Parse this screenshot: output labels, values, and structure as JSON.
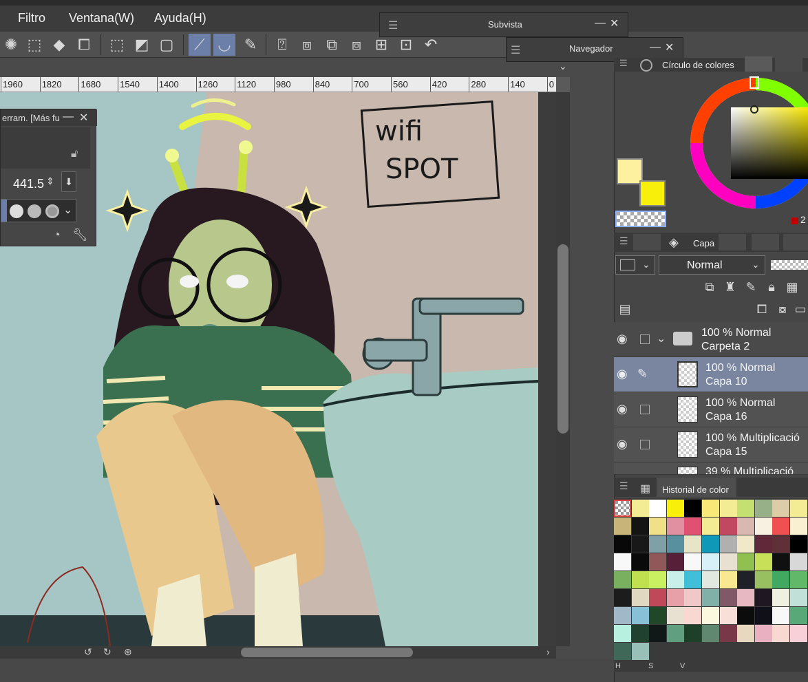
{
  "menu": {
    "items": [
      "Filtro",
      "Ventana(W)",
      "Ayuda(H)"
    ]
  },
  "subvista": {
    "title": "Subvista"
  },
  "navegador": {
    "title": "Navegador"
  },
  "ruler": {
    "labels": [
      "1960",
      "1820",
      "1680",
      "1540",
      "1400",
      "1260",
      "1120",
      "980",
      "840",
      "700",
      "560",
      "420",
      "280",
      "140",
      "0"
    ]
  },
  "tool_property": {
    "title": "erram. [Más fu",
    "brush_size": "441.5"
  },
  "color_panel": {
    "tab_label": "Círculo de colores",
    "main_color": "#fdf1a0",
    "sub_color": "#f8f00a",
    "counter": "2"
  },
  "layers": {
    "tab_label": "Capa",
    "blend_mode": "Normal",
    "rows": [
      {
        "opacity_mode": "100 % Normal",
        "name": "Carpeta 2"
      },
      {
        "opacity_mode": "100 % Normal",
        "name": "Capa 10"
      },
      {
        "opacity_mode": "100 % Normal",
        "name": "Capa 16"
      },
      {
        "opacity_mode": "100 % Multiplicació",
        "name": "Capa 15"
      },
      {
        "opacity_mode": "39 % Multiplicació",
        "name": ""
      }
    ]
  },
  "color_history": {
    "tab_label": "Historial de color",
    "footer_labels": [
      "H",
      "S",
      "V"
    ],
    "swatches": [
      "#f4ec94",
      "#ffffff",
      "#f8f00a",
      "#000000",
      "#f8e878",
      "#f4ec94",
      "#c4e070",
      "#98b088",
      "#dccca8",
      "#f4ec94",
      "#c8b478",
      "#141414",
      "#f0e088",
      "#e090a0",
      "#e05070",
      "#f4ec94",
      "#c04860",
      "#d8b8b0",
      "#f8f0e0",
      "#f05050",
      "#f8f0d0",
      "#080808",
      "#181818",
      "#80a0a8",
      "#5890a0",
      "#e8e4c8",
      "#1098b8",
      "#b0b0b0",
      "#f0e8c8",
      "#602838",
      "#603038",
      "#000000",
      "#f8f8f8",
      "#0a0a0a",
      "#905858",
      "#582038",
      "#f8f8f8",
      "#d8f0f8",
      "#e8e0d0",
      "#90c050",
      "#c8e058",
      "#101010",
      "#d8d8d8",
      "#78b060",
      "#c0e050",
      "#c8f060",
      "#c8f0e8",
      "#40c0d8",
      "#e0e8e0",
      "#f8e890",
      "#202028",
      "#98c060",
      "#40a860",
      "#60b868",
      "#1c1c1c",
      "#e0d8c0",
      "#c04858",
      "#e8a0a8",
      "#f0c8c8",
      "#80b0a8",
      "#805868",
      "#e8b8c0",
      "#201820",
      "#f0f0e0",
      "#c0e0d8",
      "#a0b8c8",
      "#88c0d8",
      "#204828",
      "#e8e0d0",
      "#f8d8d0",
      "#fcf8e0",
      "#f8e0d8",
      "#0c0c0c",
      "#101018",
      "#f8f8f8",
      "#58a878",
      "#b8f0e0",
      "#204030",
      "#101818",
      "#60a080",
      "#1c4028",
      "#608870",
      "#783848",
      "#e8d8c0",
      "#e8b0c0",
      "#f8d8d0",
      "#f8d0d8",
      "#406858",
      "#98c0b8"
    ]
  }
}
